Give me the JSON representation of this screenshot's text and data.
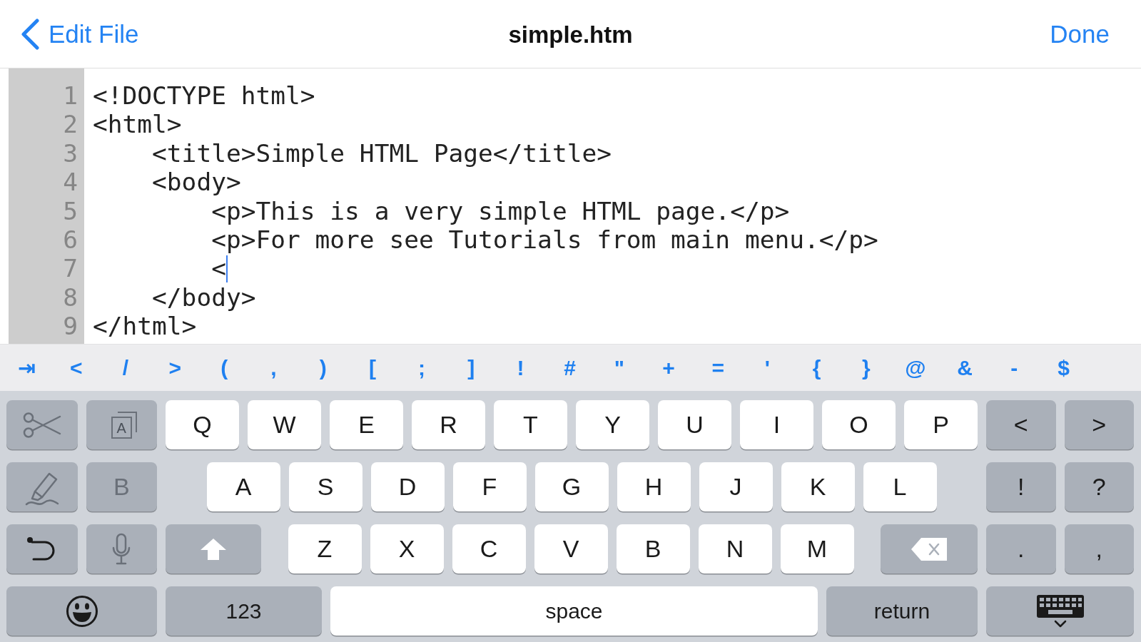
{
  "nav": {
    "back": "Edit File",
    "title": "simple.htm",
    "done": "Done"
  },
  "editor": {
    "lines": [
      {
        "number": "1",
        "text": "<!DOCTYPE html>",
        "cursor": false
      },
      {
        "number": "2",
        "text": "<html>",
        "cursor": false,
        "children": [
          {
            "number": "3",
            "text": "<title>Simple HTML Page</title>",
            "cursor": false
          },
          {
            "number": "4",
            "text": "<body>",
            "cursor": false,
            "children": [
              {
                "number": "5",
                "text": "<p>This is a very simple HTML page.</p>",
                "cursor": false
              },
              {
                "number": "6",
                "text": "<p>For more see Tutorials from main menu.</p>",
                "cursor": false
              },
              {
                "number": "7",
                "text": "<",
                "cursor": true
              }
            ]
          },
          {
            "number": "8",
            "text": "</body>",
            "cursor": false
          }
        ]
      },
      {
        "number": "9",
        "text": "</html>",
        "cursor": false
      }
    ]
  },
  "symbol_bar": {
    "keys": [
      "⇥",
      "<",
      "/",
      ">",
      "(",
      ",",
      ")",
      "[",
      ";",
      "]",
      "!",
      "#",
      "\"",
      "+",
      "=",
      "'",
      "{",
      "}",
      "@",
      "&",
      "-",
      "$"
    ]
  },
  "keyboard": {
    "rows": [
      {
        "left": [
          {
            "kind": "cut",
            "disabled": true
          },
          {
            "kind": "format",
            "label": "A",
            "disabled": true
          }
        ],
        "main": [
          {
            "kind": "letter",
            "label": "Q"
          },
          {
            "kind": "letter",
            "label": "W"
          },
          {
            "kind": "letter",
            "label": "E"
          },
          {
            "kind": "letter",
            "label": "R"
          },
          {
            "kind": "letter",
            "label": "T"
          },
          {
            "kind": "letter",
            "label": "Y"
          },
          {
            "kind": "letter",
            "label": "U"
          },
          {
            "kind": "letter",
            "label": "I"
          },
          {
            "kind": "letter",
            "label": "O"
          },
          {
            "kind": "letter",
            "label": "P"
          }
        ],
        "right": [
          {
            "kind": "symbol",
            "label": "<"
          },
          {
            "kind": "symbol",
            "label": ">"
          }
        ]
      },
      {
        "left": [
          {
            "kind": "highlight",
            "disabled": true
          },
          {
            "kind": "text",
            "label": "B",
            "disabled": true
          }
        ],
        "main": [
          {
            "kind": "letter",
            "label": "A"
          },
          {
            "kind": "letter",
            "label": "S"
          },
          {
            "kind": "letter",
            "label": "D"
          },
          {
            "kind": "letter",
            "label": "F"
          },
          {
            "kind": "letter",
            "label": "G"
          },
          {
            "kind": "letter",
            "label": "H"
          },
          {
            "kind": "letter",
            "label": "J"
          },
          {
            "kind": "letter",
            "label": "K"
          },
          {
            "kind": "letter",
            "label": "L"
          }
        ],
        "right": [
          {
            "kind": "symbol",
            "label": "!"
          },
          {
            "kind": "symbol",
            "label": "?"
          }
        ]
      },
      {
        "left": [
          {
            "kind": "undo",
            "disabled": false
          },
          {
            "kind": "dictation",
            "disabled": true
          }
        ],
        "main": [
          {
            "kind": "shift"
          },
          {
            "kind": "letter",
            "label": "Z"
          },
          {
            "kind": "letter",
            "label": "X"
          },
          {
            "kind": "letter",
            "label": "C"
          },
          {
            "kind": "letter",
            "label": "V"
          },
          {
            "kind": "letter",
            "label": "B"
          },
          {
            "kind": "letter",
            "label": "N"
          },
          {
            "kind": "letter",
            "label": "M"
          },
          {
            "kind": "delete"
          }
        ],
        "right": [
          {
            "kind": "symbol",
            "label": "."
          },
          {
            "kind": "symbol",
            "label": ","
          }
        ]
      },
      {
        "left": [
          {
            "kind": "emoji",
            "disabled": false
          }
        ],
        "main": [
          {
            "kind": "mode",
            "label": "123"
          },
          {
            "kind": "space",
            "label": "space"
          },
          {
            "kind": "return",
            "label": "return"
          }
        ],
        "right": [
          {
            "kind": "dismiss"
          }
        ]
      }
    ]
  }
}
